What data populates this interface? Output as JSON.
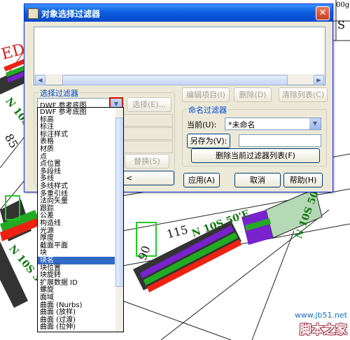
{
  "window": {
    "title": "对象选择过滤器",
    "close_glyph": "✕"
  },
  "background": {
    "red_text": "ED",
    "green_labels": [
      "N 10S 10'E",
      "N 10S 50'E",
      "N 10S 30'E",
      "N 10S 50'E"
    ],
    "dim_labels": [
      "85",
      "115",
      "90"
    ],
    "corner_text_top": "00g",
    "corner_letter": "S"
  },
  "filter_group": {
    "label": "选择过滤器",
    "combo_value": "DWF 参考底图",
    "select_button": "选择(E)...",
    "replace_button": "替换(S)"
  },
  "toolbar": {
    "edit_item": "编辑项目(I)",
    "delete": "删除(D)",
    "clear_list": "清除列表(C)"
  },
  "named_filter": {
    "label": "命名过滤器",
    "current_label": "当前(U):",
    "current_value": "*未命名",
    "save_as_button": "另存为(V):",
    "delete_button": "删除当前过滤器列表(F)"
  },
  "buttons": {
    "apply": "应用(A)",
    "cancel": "取消",
    "help": "帮助(H)"
  },
  "dropdown_items": [
    "DWF 参考底图",
    "标高",
    "标注",
    "标注样式",
    "表格",
    "材质",
    "点",
    "点位置",
    "多段线",
    "多线",
    "多线样式",
    "多重引线",
    "法向矢量",
    "跟踪",
    "公差",
    "构造线",
    "光源",
    "厚度",
    "截面平面",
    "块",
    "块名",
    "块位置",
    "块旋转",
    "扩展数据 ID",
    "螺旋",
    "面域",
    "曲面 (Nurbs)",
    "曲面 (放样)",
    "曲面 (过渡)",
    "曲面 (拉伸)"
  ],
  "selected_item": "块名",
  "watermark": {
    "url": "www.jb51.net",
    "name": "脚本之家"
  }
}
